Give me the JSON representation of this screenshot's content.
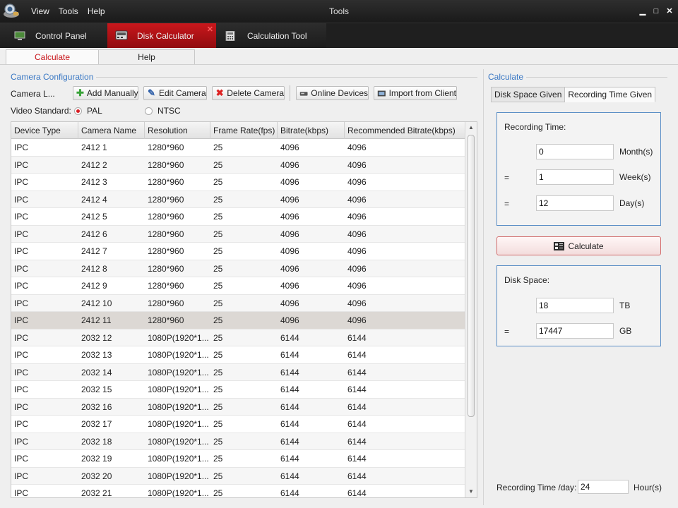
{
  "titlebar": {
    "menu": [
      "View",
      "Tools",
      "Help"
    ],
    "title": "Tools",
    "controls": {
      "minimize": "▁",
      "restore": "□",
      "close": "✕"
    }
  },
  "module_tabs": [
    {
      "label": "Control Panel",
      "icon": "monitor-icon"
    },
    {
      "label": "Disk Calculator",
      "icon": "hdd-icon"
    },
    {
      "label": "Calculation Tool",
      "icon": "calculator-icon"
    }
  ],
  "sub_tabs": [
    "Calculate",
    "Help"
  ],
  "camera_config": {
    "title": "Camera Configuration",
    "camera_label": "Camera L...",
    "buttons": {
      "add_manually": "Add Manually",
      "edit_camera": "Edit Camera",
      "delete_camera": "Delete Camera",
      "online_devices": "Online Devices",
      "import_from_client": "Import from Client"
    },
    "video_standard_label": "Video Standard:",
    "video_standard_options": [
      "PAL",
      "NTSC"
    ],
    "video_standard_selected": "PAL"
  },
  "table": {
    "columns": [
      "Device Type",
      "Camera Name",
      "Resolution",
      "Frame Rate(fps)",
      "Bitrate(kbps)",
      "Recommended Bitrate(kbps)"
    ],
    "selected_row": 10,
    "rows": [
      [
        "IPC",
        "2412 1",
        "1280*960",
        "25",
        "4096",
        "4096"
      ],
      [
        "IPC",
        "2412 2",
        "1280*960",
        "25",
        "4096",
        "4096"
      ],
      [
        "IPC",
        "2412 3",
        "1280*960",
        "25",
        "4096",
        "4096"
      ],
      [
        "IPC",
        "2412 4",
        "1280*960",
        "25",
        "4096",
        "4096"
      ],
      [
        "IPC",
        "2412 5",
        "1280*960",
        "25",
        "4096",
        "4096"
      ],
      [
        "IPC",
        "2412 6",
        "1280*960",
        "25",
        "4096",
        "4096"
      ],
      [
        "IPC",
        "2412 7",
        "1280*960",
        "25",
        "4096",
        "4096"
      ],
      [
        "IPC",
        "2412 8",
        "1280*960",
        "25",
        "4096",
        "4096"
      ],
      [
        "IPC",
        "2412 9",
        "1280*960",
        "25",
        "4096",
        "4096"
      ],
      [
        "IPC",
        "2412 10",
        "1280*960",
        "25",
        "4096",
        "4096"
      ],
      [
        "IPC",
        "2412 11",
        "1280*960",
        "25",
        "4096",
        "4096"
      ],
      [
        "IPC",
        "2032 12",
        "1080P(1920*1...",
        "25",
        "6144",
        "6144"
      ],
      [
        "IPC",
        "2032 13",
        "1080P(1920*1...",
        "25",
        "6144",
        "6144"
      ],
      [
        "IPC",
        "2032 14",
        "1080P(1920*1...",
        "25",
        "6144",
        "6144"
      ],
      [
        "IPC",
        "2032 15",
        "1080P(1920*1...",
        "25",
        "6144",
        "6144"
      ],
      [
        "IPC",
        "2032 16",
        "1080P(1920*1...",
        "25",
        "6144",
        "6144"
      ],
      [
        "IPC",
        "2032 17",
        "1080P(1920*1...",
        "25",
        "6144",
        "6144"
      ],
      [
        "IPC",
        "2032 18",
        "1080P(1920*1...",
        "25",
        "6144",
        "6144"
      ],
      [
        "IPC",
        "2032 19",
        "1080P(1920*1...",
        "25",
        "6144",
        "6144"
      ],
      [
        "IPC",
        "2032 20",
        "1080P(1920*1...",
        "25",
        "6144",
        "6144"
      ],
      [
        "IPC",
        "2032 21",
        "1080P(1920*1...",
        "25",
        "6144",
        "6144"
      ]
    ]
  },
  "calculate_panel": {
    "title": "Calculate",
    "tabs": [
      "Disk Space Given",
      "Recording Time Given"
    ],
    "active_tab": "Recording Time Given",
    "recording_time": {
      "label": "Recording Time:",
      "month_value": "0",
      "month_unit": "Month(s)",
      "week_prefix": "=",
      "week_value": "1",
      "week_unit": "Week(s)",
      "day_prefix": "=",
      "day_value": "12",
      "day_unit": "Day(s)"
    },
    "calculate_button": "Calculate",
    "disk_space": {
      "label": "Disk Space:",
      "tb_value": "18",
      "tb_unit": "TB",
      "gb_prefix": "=",
      "gb_value": "17447",
      "gb_unit": "GB"
    },
    "hours_per_day": {
      "label": "Recording Time /day:",
      "value": "24",
      "unit": "Hour(s)"
    }
  },
  "colors": {
    "accent_red": "#c8161b",
    "group_blue": "#3a78c4",
    "panel_border": "#5b8fc6"
  }
}
